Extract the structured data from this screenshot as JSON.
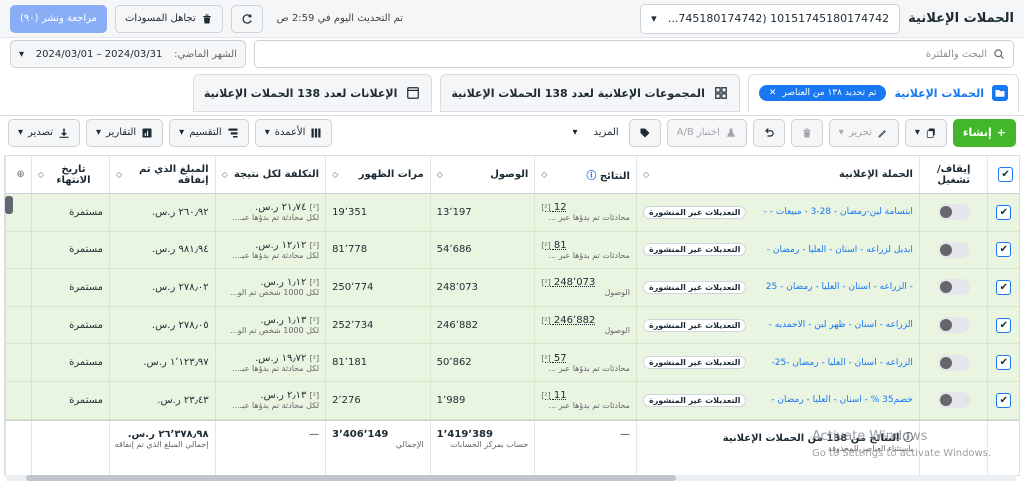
{
  "header": {
    "title": "الحملات الإعلانية",
    "account_value": "...745180174742) 10151745180174742",
    "updated_text": "تم التحديث اليوم في 2:59 ص",
    "discard_label": "تجاهل المسودات",
    "review_label": "مراجعة ونشر (٩٠)"
  },
  "search": {
    "placeholder": "البحث والفلترة",
    "date_label": "الشهر الماضي:",
    "date_value": "2024/03/01 – 2024/03/31"
  },
  "tabs": {
    "campaigns": "الحملات الإعلانية",
    "selected_chip": "تم تحديد ١٣٨ من العناصر",
    "adsets": "المجموعات الإعلانية لعدد 138 الحملات الإعلانية",
    "ads": "الإعلانات لعدد 138 الحملات الإعلانية"
  },
  "toolbar": {
    "create": "إنشاء",
    "edit": "تحرير",
    "ab_test": "اختبار A/B",
    "more": "المزيد",
    "columns": "الأعمدة",
    "breakdown": "التقسيم",
    "reports": "التقارير",
    "export": "تصدير"
  },
  "columns": {
    "toggle": "إيقاف/ تشغيل",
    "campaign": "الحملة الإعلانية",
    "results": "النتائج",
    "reach": "الوصول",
    "impressions": "مرات الظهور",
    "cost_per_result": "التكلفة لكل نتيجة",
    "amount_spent": "المبلغ الذي تم إنفاقه",
    "end_date": "تاريخ الانتهاء"
  },
  "rows": [
    {
      "name": "ابتسامة لين-رمضان - 28-3 - مبيعات - -",
      "badge": "التعديلات غير المنشورة",
      "results": "12",
      "results_sub": "محادثات تم بدؤها عبر ...",
      "reach": "13٬197",
      "impressions": "19٬351",
      "cpr": "٢١٫٧٤ ر.س.",
      "cpr_sub": "لكل محادثة تم بدؤها عبـ...",
      "spent": "٢٦٠٫٩٢ ر.س.",
      "end": "مستمرة"
    },
    {
      "name": "ابديل لزراعه - اسنان - العليا - رمضان -",
      "badge": "التعديلات غير المنشورة",
      "results": "81",
      "results_sub": "محادثات تم بدؤها عبر ...",
      "reach": "54٬686",
      "impressions": "81٬778",
      "cpr": "١٢٫١٢ ر.س.",
      "cpr_sub": "لكل محادثة تم بدؤها عبـ...",
      "spent": "٩٨١٫٩٤ ر.س.",
      "end": "مستمرة"
    },
    {
      "name": "- الزراعه - اسنان - العليا - رمضان - 25",
      "badge": "التعديلات غير المنشورة",
      "results": "248٬073",
      "results_sub": "الوصول",
      "reach": "248٬073",
      "impressions": "250٬774",
      "cpr": "١٫١٢ ر.س.",
      "cpr_sub": "لكل 1000 شخص تم الو...",
      "spent": "٢٧٨٫٠٢ ر.س.",
      "end": "مستمرة"
    },
    {
      "name": "الزراعه - اسنان - ظهر لبن - الاحمديه -",
      "badge": "التعديلات غير المنشورة",
      "results": "246٬882",
      "results_sub": "الوصول",
      "reach": "246٬882",
      "impressions": "252٬734",
      "cpr": "١٫١٣ ر.س.",
      "cpr_sub": "لكل 1000 شخص تم الو...",
      "spent": "٢٧٨٫٠٥ ر.س.",
      "end": "مستمرة"
    },
    {
      "name": "الزراعه - اسنان - العليا - رمضان -25-",
      "badge": "التعديلات غير المنشورة",
      "results": "57",
      "results_sub": "محادثات تم بدؤها عبر ...",
      "reach": "50٬862",
      "impressions": "81٬181",
      "cpr": "١٩٫٧٢ ر.س.",
      "cpr_sub": "لكل محادثة تم بدؤها عبـ...",
      "spent": "١٬١٢٣٫٩٧ ر.س.",
      "end": "مستمرة"
    },
    {
      "name": "خصم35 % - اسنان - العليا - رمضان -",
      "badge": "التعديلات غير المنشورة",
      "results": "11",
      "results_sub": "محادثات تم بدؤها عبر ...",
      "reach": "1٬989",
      "impressions": "2٬276",
      "cpr": "٢٫١٣ ر.س.",
      "cpr_sub": "لكل محادثة تم بدؤها عبـ...",
      "spent": "٢٣٫٤٣ ر.س.",
      "end": "مستمرة"
    }
  ],
  "totals": {
    "label": "النتائج من 138 من الحملات الإعلانية",
    "label_sub": "باستثناء العناصر المحذوفة",
    "results": "—",
    "reach": "1٬419٬389",
    "reach_sub": "حساب بمركز الحسابات",
    "impressions": "3٬406٬149",
    "impressions_sub": "الإجمالي",
    "cpr": "—",
    "spent": "٢٦٬٣٧٨٫٩٨ ر.س.",
    "spent_sub": "إجمالي المبلغ الذي تم إنفاقه"
  },
  "watermark": {
    "title": "Activate Windows",
    "subtitle": "Go to Settings to activate Windows."
  }
}
